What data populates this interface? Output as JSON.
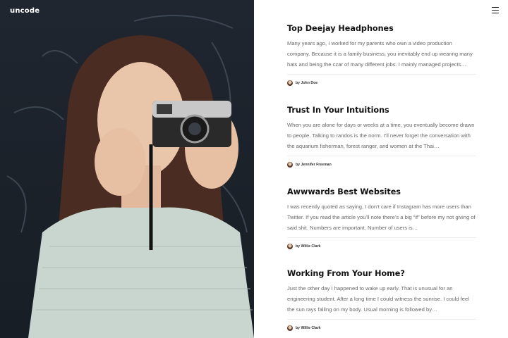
{
  "brand": {
    "logo": "uncode"
  },
  "header": {
    "menu_icon": "hamburger-menu-icon"
  },
  "posts": [
    {
      "title": "Top Deejay Headphones",
      "excerpt": "Many years ago, I worked for my parents who own a video production company. Because it is a family business, you inevitably end up wearing many hats and being the czar of many different jobs. I mainly managed projects…",
      "author": "by John Doe"
    },
    {
      "title": "Trust In Your Intuitions",
      "excerpt": "When you are alone for days or weeks at a time, you eventually become drawn to people. Talking to randos is the norm. I’ll never forget the conversation with the aquarium fisherman, forest ranger, and women at the Thai…",
      "author": "by Jennifer Freeman"
    },
    {
      "title": "Awwwards Best Websites",
      "excerpt": "I was recently quoted as saying, I don’t care if Instagram has more users than Twitter. If you read the article you’ll note there’s a big “if” before my not giving of said shit. Numbers are important. Number of users is…",
      "author": "by Willie Clark"
    },
    {
      "title": "Working From Your Home?",
      "excerpt": "Just the other day I happened to wake up early. That is unusual for an engineering student. After a long time I could witness the sunrise. I could feel the sun rays falling on my body. Usual morning is followed by…",
      "author": "by Willie Clark"
    }
  ],
  "colors": {
    "hero_bg": "#1d242d",
    "title": "#111111",
    "excerpt": "#676767",
    "divider": "#ececec"
  }
}
